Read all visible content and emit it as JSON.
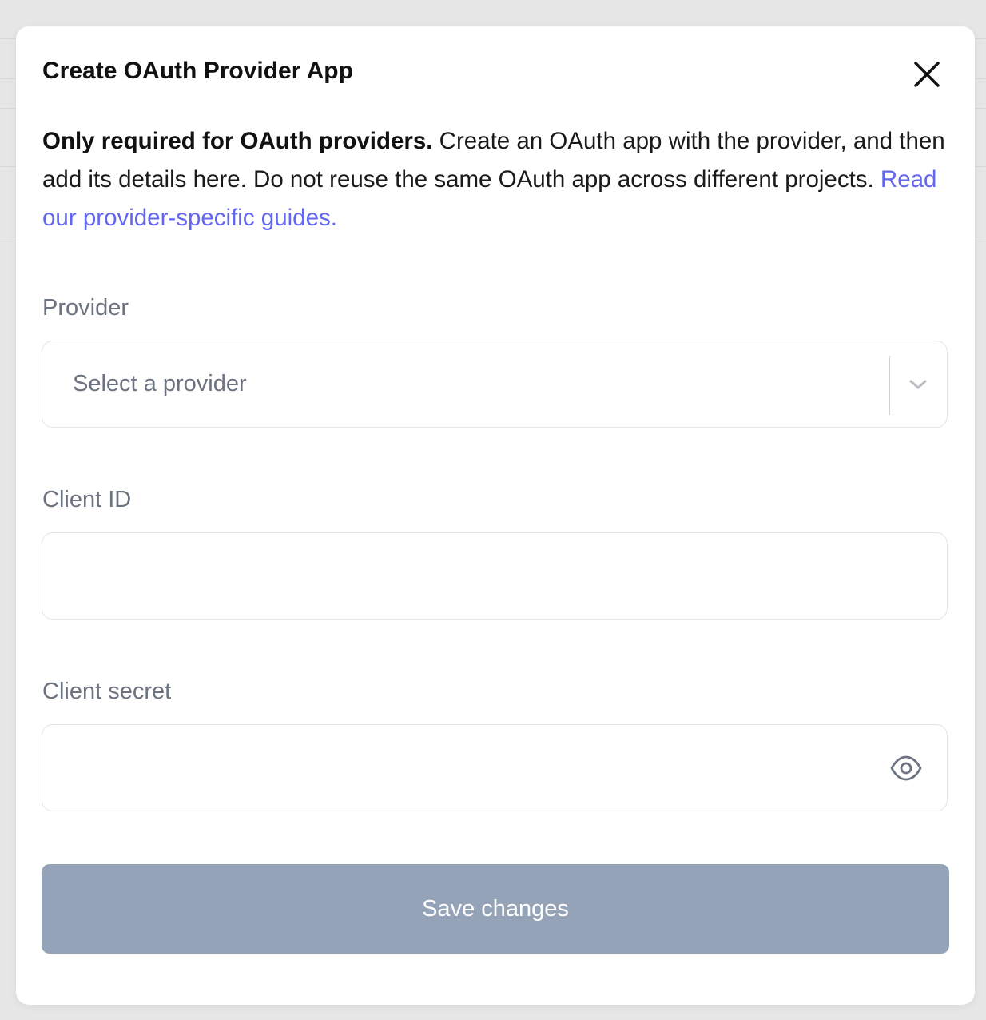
{
  "modal": {
    "title": "Create OAuth Provider App",
    "description": {
      "bold": "Only required for OAuth providers.",
      "text": " Create an OAuth app with the provider, and then add its details here. Do not reuse the same OAuth app across different projects. ",
      "link": "Read our provider-specific guides."
    },
    "provider": {
      "label": "Provider",
      "placeholder": "Select a provider"
    },
    "client_id": {
      "label": "Client ID",
      "value": ""
    },
    "client_secret": {
      "label": "Client secret",
      "value": ""
    },
    "save_label": "Save changes"
  },
  "colors": {
    "link": "#6366f1",
    "button": "#94a3b8",
    "label": "#6b7280"
  },
  "icons": {
    "close": "close-icon",
    "dropdown": "chevron-down-icon",
    "reveal": "eye-icon"
  }
}
